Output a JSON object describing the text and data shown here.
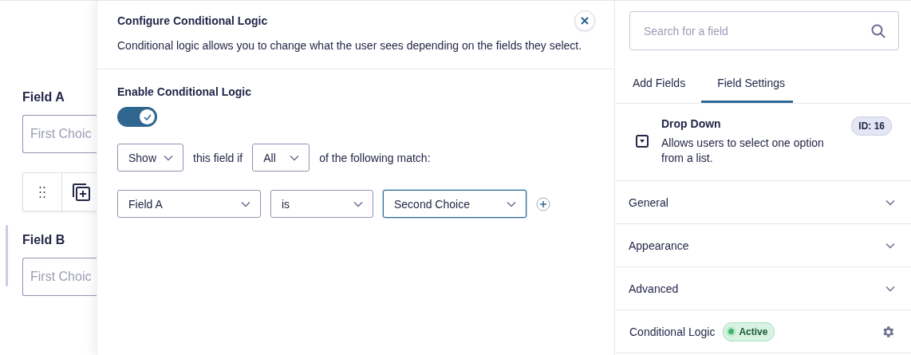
{
  "canvas": {
    "fields": [
      {
        "label": "Field A",
        "placeholder": "First Choic",
        "selected": false
      },
      {
        "label": "Field B",
        "placeholder": "First Choic",
        "selected": true
      }
    ]
  },
  "modal": {
    "title": "Configure Conditional Logic",
    "description": "Conditional logic allows you to change what the user sees depending on the fields they select.",
    "toggle": {
      "label": "Enable Conditional Logic",
      "on": true
    },
    "action": "Show",
    "connector": "this field if",
    "logic": "All",
    "suffix": "of the following match:",
    "rule": [
      {
        "value": "Field A",
        "focused": false
      },
      {
        "value": "is",
        "focused": false
      },
      {
        "value": "Second Choice",
        "focused": true
      }
    ]
  },
  "sidebar": {
    "search": {
      "placeholder": "Search for a field"
    },
    "tabs": [
      {
        "label": "Add Fields",
        "selected": false
      },
      {
        "label": "Field Settings",
        "selected": true
      }
    ],
    "field": {
      "title": "Drop Down",
      "description": "Allows users to select one option from a list.",
      "id_badge": "ID: 16"
    },
    "sections": [
      {
        "kind": "accordion",
        "label": "General",
        "expanded": false
      },
      {
        "kind": "accordion",
        "label": "Appearance",
        "expanded": false
      },
      {
        "kind": "accordion",
        "label": "Advanced",
        "expanded": false
      },
      {
        "kind": "setting",
        "label": "Conditional Logic",
        "badge": "Active"
      }
    ]
  }
}
